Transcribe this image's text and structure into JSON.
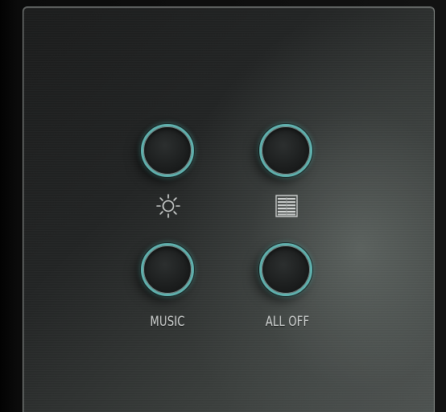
{
  "panel": {
    "buttons": [
      {
        "id": "lights",
        "icon": "sun-icon",
        "label": ""
      },
      {
        "id": "blinds",
        "icon": "blinds-icon",
        "label": ""
      },
      {
        "id": "music",
        "icon": "",
        "label": "MUSIC"
      },
      {
        "id": "all_off",
        "icon": "",
        "label": "ALL OFF"
      }
    ]
  },
  "colors": {
    "ring_accent": "#5fb0ad",
    "label_text": "#d4d7d6",
    "panel_dark": "#1c1d1d",
    "panel_light": "#4f5452"
  }
}
